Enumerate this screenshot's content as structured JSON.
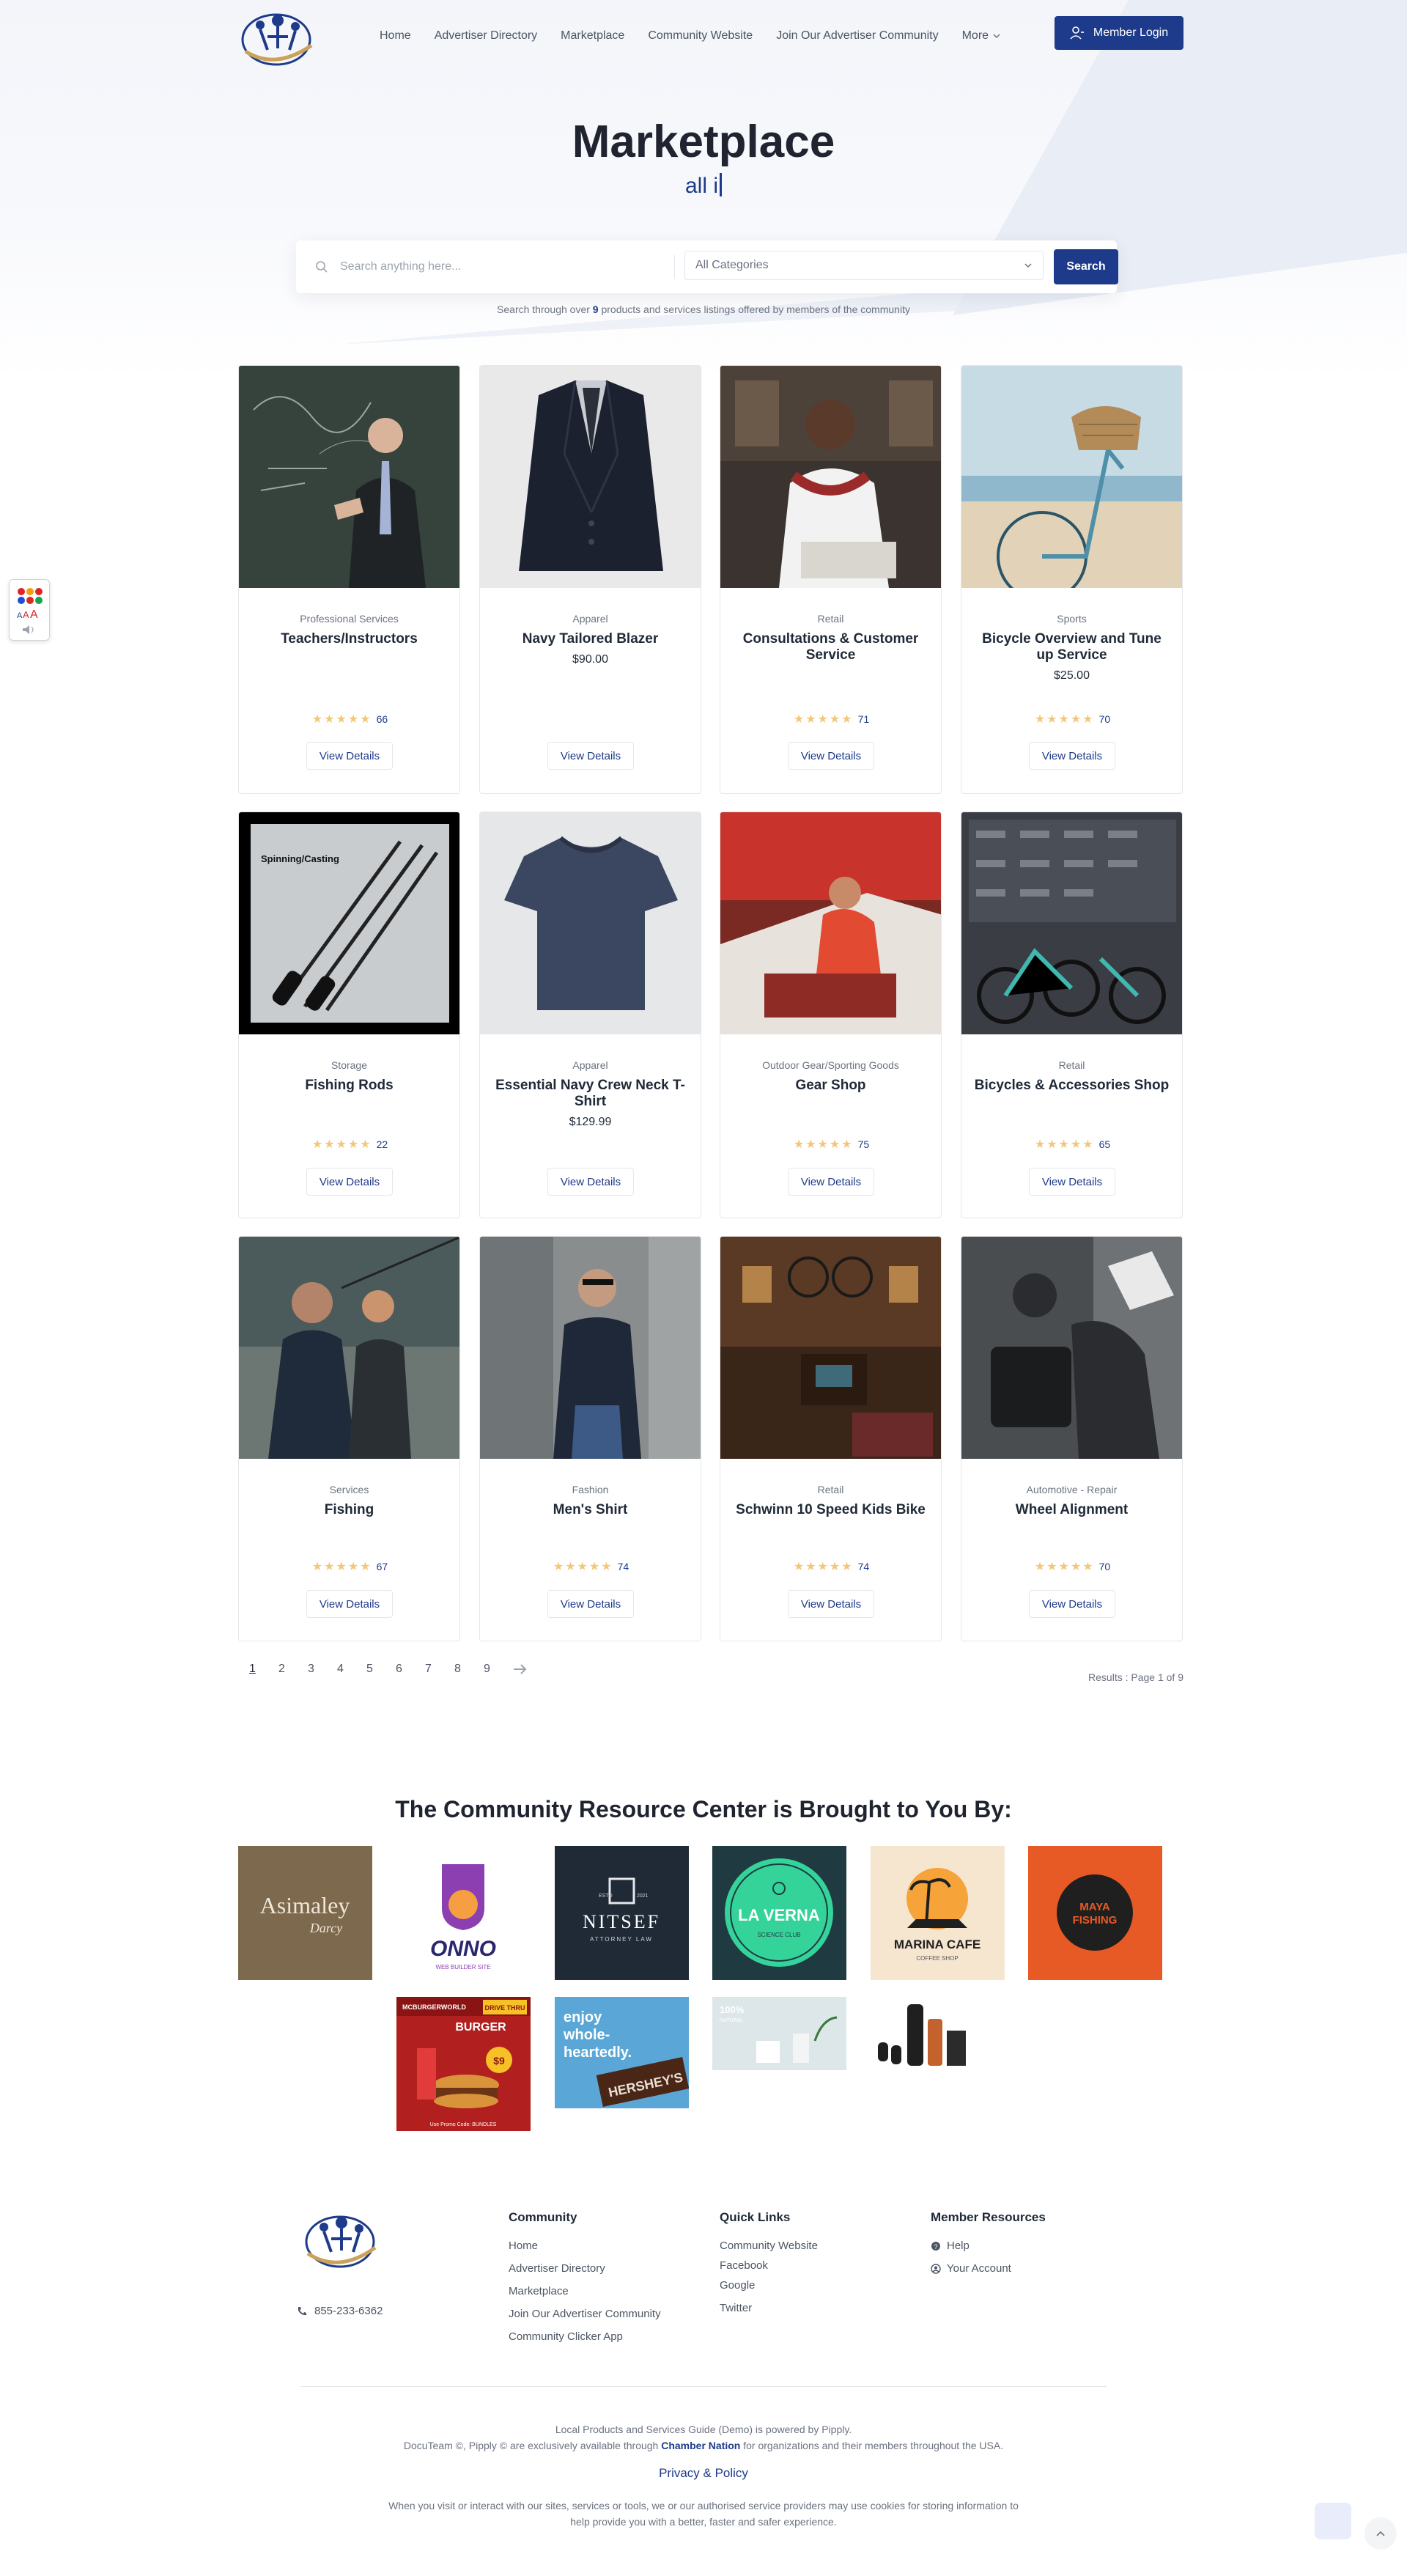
{
  "nav": {
    "links": [
      "Home",
      "Advertiser Directory",
      "Marketplace",
      "Community Website",
      "Join Our Advertiser Community"
    ],
    "more": "More",
    "login": "Member Login"
  },
  "hero": {
    "title": "Marketplace",
    "typed": "all i"
  },
  "search": {
    "placeholder": "Search anything here...",
    "category": "All Categories",
    "button": "Search",
    "note_prefix": "Search through over",
    "note_count": "9",
    "note_suffix": "products and services listings offered by members of the community"
  },
  "colors": {
    "accent": "#1e3a8a",
    "star": "#f3c77a"
  },
  "products": [
    {
      "category": "Professional Services",
      "title": "Teachers/Instructors",
      "price": "",
      "rating_count": "66"
    },
    {
      "category": "Apparel",
      "title": "Navy Tailored Blazer",
      "price": "$90.00",
      "rating_count": ""
    },
    {
      "category": "Retail",
      "title": "Consultations & Customer Service",
      "price": "",
      "rating_count": "71"
    },
    {
      "category": "Sports",
      "title": "Bicycle Overview and Tune up Service",
      "price": "$25.00",
      "rating_count": "70"
    },
    {
      "category": "Storage",
      "title": "Fishing Rods",
      "price": "",
      "rating_count": "22"
    },
    {
      "category": "Apparel",
      "title": "Essential Navy Crew Neck T-Shirt",
      "price": "$129.99",
      "rating_count": ""
    },
    {
      "category": "Outdoor Gear/Sporting Goods",
      "title": "Gear Shop",
      "price": "",
      "rating_count": "75"
    },
    {
      "category": "Retail",
      "title": "Bicycles & Accessories Shop",
      "price": "",
      "rating_count": "65"
    },
    {
      "category": "Services",
      "title": "Fishing",
      "price": "",
      "rating_count": "67"
    },
    {
      "category": "Fashion",
      "title": "Men's Shirt",
      "price": "",
      "rating_count": "74"
    },
    {
      "category": "Retail",
      "title": "Schwinn 10 Speed Kids Bike",
      "price": "",
      "rating_count": "74"
    },
    {
      "category": "Automotive - Repair",
      "title": "Wheel Alignment",
      "price": "",
      "rating_count": "70"
    }
  ],
  "details_label": "View Details",
  "fishing_rod_overlay": "Spinning/Casting",
  "pagination": {
    "pages": [
      "1",
      "2",
      "3",
      "4",
      "5",
      "6",
      "7",
      "8",
      "9"
    ],
    "results": "Results : Page 1 of 9"
  },
  "sponsors": {
    "title": "The Community Resource Center is Brought to You By:",
    "asimaley": [
      "Asimaley",
      "Darcy"
    ],
    "onno": [
      "ONNO",
      "WEB BUILDER SITE"
    ],
    "nitsef": [
      "NITSEF",
      "ATTORNEY LAW",
      "ESTD",
      "2021"
    ],
    "laverna": [
      "LA VERNA",
      "SCIENCE CLUB"
    ],
    "marina": [
      "MARINA CAFE",
      "COFFEE SHOP"
    ],
    "maya": [
      "MAYA",
      "FISHING"
    ],
    "burger": [
      "MCBURGERWORLD",
      "DRIVE THRU",
      "BURGER",
      "$9",
      "Use Promo Code: BUNDLES"
    ],
    "hershey": [
      "enjoy",
      "whole-",
      "heartedly.",
      "HERSHEY'S"
    ],
    "natural": [
      "100%",
      "NATURAL"
    ]
  },
  "footer": {
    "phone": "855-233-6362",
    "community_title": "Community",
    "community": [
      "Home",
      "Advertiser Directory",
      "Marketplace",
      "Join Our Advertiser Community",
      "Community Clicker App"
    ],
    "quick_title": "Quick Links",
    "quick": [
      "Community Website",
      "Facebook",
      "Google",
      "Twitter"
    ],
    "member_title": "Member Resources",
    "member": [
      "Help",
      "Your Account"
    ],
    "powered": "Local Products and Services Guide (Demo) is powered by Pipply.",
    "docuteam_prefix": "DocuTeam ©, Pipply © are exclusively available through",
    "docuteam_link": "Chamber Nation",
    "docuteam_suffix": "for organizations and their members throughout the USA.",
    "privacy": "Privacy & Policy",
    "cookies_1": "When you visit or interact with our sites, services or tools, we or our authorised service providers may use cookies for storing information to",
    "cookies_2": "help provide you with a better, faster and safer experience."
  }
}
